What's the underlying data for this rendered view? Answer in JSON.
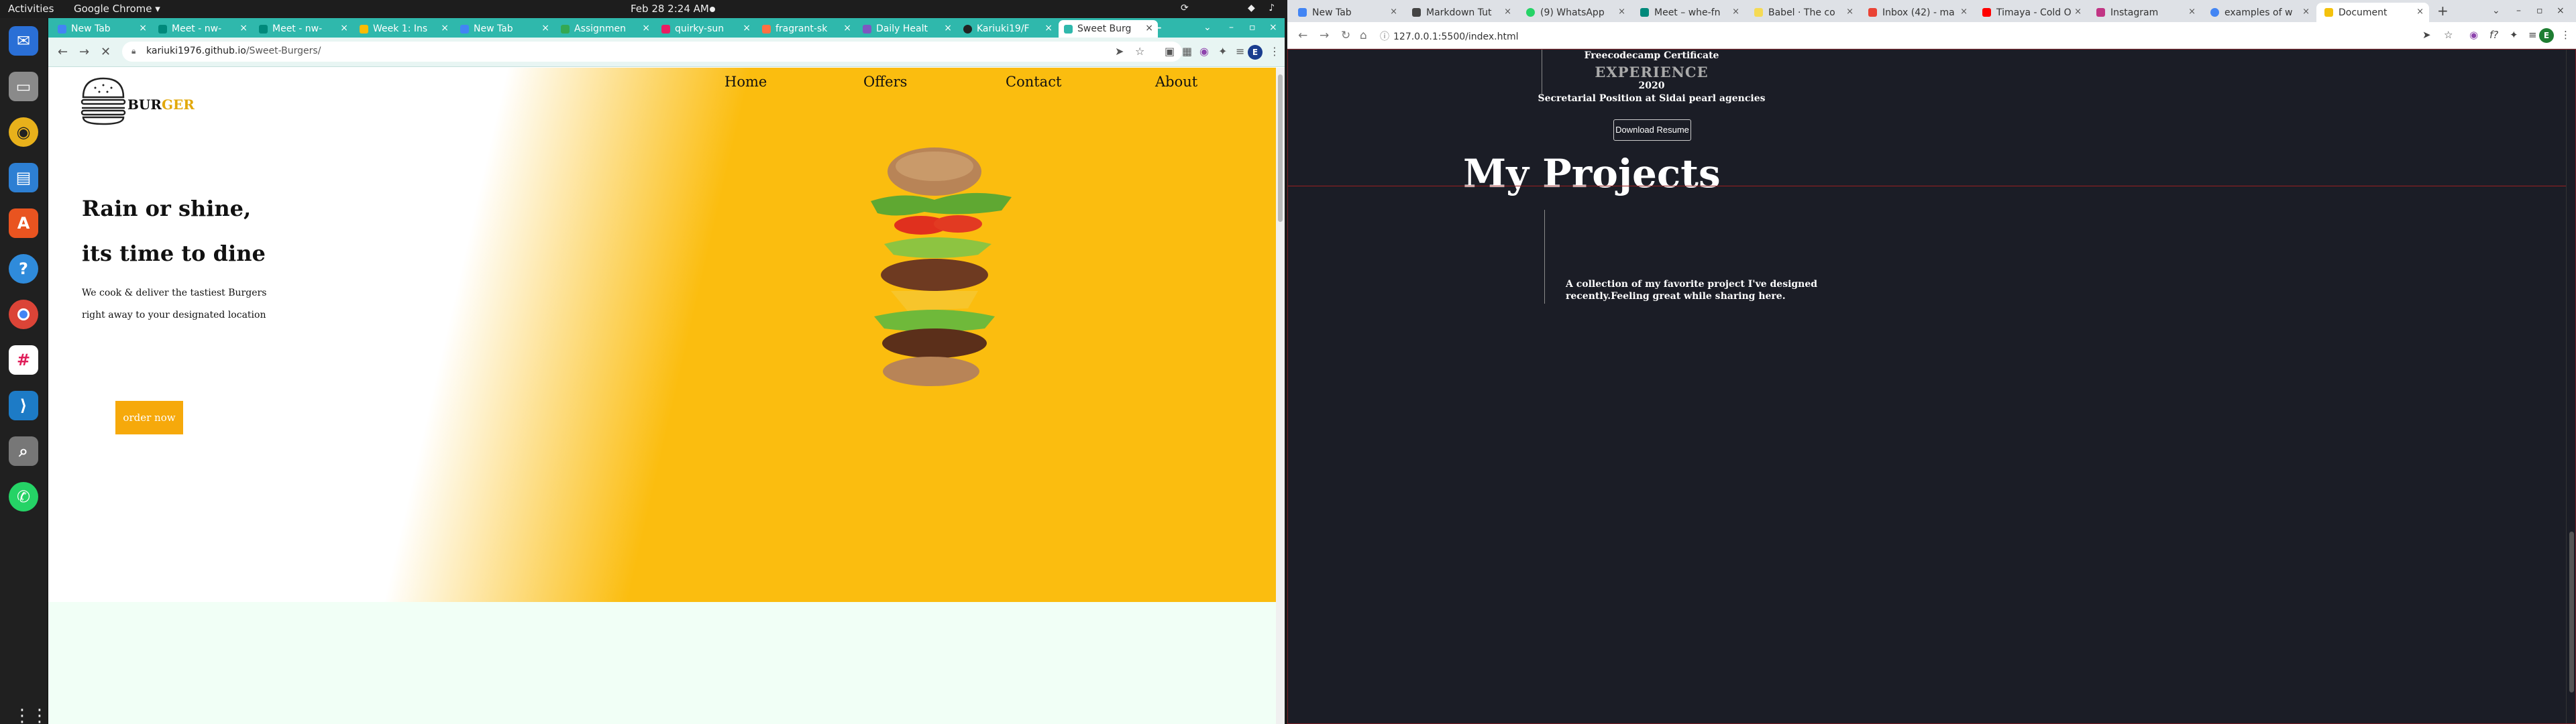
{
  "system": {
    "activities": "Activities",
    "app_name": "Google Chrome ▾",
    "clock": "Feb 28  2:24 AM"
  },
  "dock": {
    "apps": [
      "Thunderbird",
      "Files",
      "Rhythmbox",
      "LibreOffice Writer",
      "Ubuntu Software",
      "Help",
      "Google Chrome",
      "Slack",
      "Visual Studio Code",
      "Image Viewer",
      "WhatsApp"
    ],
    "show_apps": "⋮⋮⋮"
  },
  "left_browser": {
    "tabs": [
      {
        "label": "New Tab",
        "color": "#4285f4"
      },
      {
        "label": "Meet - nw-",
        "color": "#00897b"
      },
      {
        "label": "Meet - nw-",
        "color": "#00897b"
      },
      {
        "label": "Week 1: Ins",
        "color": "#fbbc05"
      },
      {
        "label": "New Tab",
        "color": "#4285f4"
      },
      {
        "label": "Assignmen",
        "color": "#34a853"
      },
      {
        "label": "quirky-sun",
        "color": "#e91e63"
      },
      {
        "label": "fragrant-sk",
        "color": "#ff7043"
      },
      {
        "label": "Daily Healt",
        "color": "#7e57c2"
      },
      {
        "label": "Kariuki19/F",
        "color": "#222222"
      },
      {
        "label": "Sweet Burg",
        "color": "#2fb8ac"
      }
    ],
    "new_tab": "+",
    "url_domain": "kariuki1976.github.io",
    "url_path": "/Sweet-Burgers/",
    "profile_initial": "E",
    "site": {
      "logo_bur": "BUR",
      "logo_ger": "GER",
      "menu": [
        "Home",
        "Offers",
        "Contact",
        "About"
      ],
      "headline1": "Rain or shine,",
      "headline2": "its time to dine",
      "desc1": "We cook & deliver the tastiest Burgers",
      "desc2": "right away to your designated location",
      "order_button": "order now"
    }
  },
  "right_browser": {
    "tabs": [
      {
        "label": "New Tab",
        "color": "#4285f4"
      },
      {
        "label": "Markdown Tut",
        "color": "#444444"
      },
      {
        "label": "(9) WhatsApp",
        "color": "#25d366"
      },
      {
        "label": "Meet – whe-fn",
        "color": "#00897b"
      },
      {
        "label": "Babel · The co",
        "color": "#f5da55"
      },
      {
        "label": "Inbox (42) - ma",
        "color": "#ea4335"
      },
      {
        "label": "Timaya - Cold O",
        "color": "#ff0000"
      },
      {
        "label": "Instagram",
        "color": "#c13584"
      },
      {
        "label": "examples of w",
        "color": "#4285f4"
      },
      {
        "label": "Document",
        "color": "#f4c20d"
      }
    ],
    "new_tab": "+",
    "url": "127.0.0.1:5500/index.html",
    "profile_initial": "E",
    "site": {
      "cert_text": "Freecodecamp Certificate",
      "experience_title": "EXPERIENCE",
      "experience_year": "2020",
      "experience_role": "Secretarial Position at Sidai pearl agencies",
      "download_button": "Download Resume",
      "projects_title": "My Projects",
      "projects_desc": "A collection of my favorite project I've designed recently.Feeling great while sharing here."
    }
  }
}
